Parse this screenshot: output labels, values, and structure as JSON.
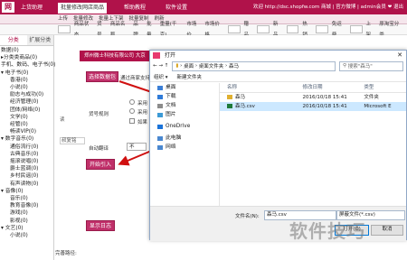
{
  "topnav": {
    "logo": "网",
    "tabs": [
      "上货助理",
      "批量修改网店商品",
      "帮助教程",
      "软件设置"
    ],
    "active_tab": 1,
    "right_text": "欢迎 http://dsc.shopfw.com 商城 | 官方微博 | admin会员 ❤ 退出"
  },
  "subnav": [
    "上传",
    "批量修改",
    "批量上下架",
    "批量复制",
    "刷新"
  ],
  "toolbar": [
    "商品状态",
    "货号",
    "商品名称",
    "品牌",
    "批量",
    "重量(千克)",
    "市场价",
    "市场价格",
    "赠品",
    "新品",
    "热销",
    "免运费",
    "上架",
    "原淘宝分类"
  ],
  "sidebar": {
    "tabs": [
      "分类",
      "扩展分类"
    ],
    "tree": [
      {
        "level": 1,
        "text": "数据(0)"
      },
      {
        "level": 1,
        "text": "▸分类类商品(0)"
      },
      {
        "level": 1,
        "text": "手机、数码、电子书(0)"
      },
      {
        "level": 1,
        "text": "▾ 电子书(0)"
      },
      {
        "level": 2,
        "text": "香港(0)"
      },
      {
        "level": 2,
        "text": "小说(0)"
      },
      {
        "level": 2,
        "text": "励志与成功(0)"
      },
      {
        "level": 2,
        "text": "经济管理(0)"
      },
      {
        "level": 2,
        "text": "团体/网络(0)"
      },
      {
        "level": 2,
        "text": "文学(0)"
      },
      {
        "level": 2,
        "text": "经管(0)"
      },
      {
        "level": 2,
        "text": "畅读VIP(0)"
      },
      {
        "level": 1,
        "text": "▾ 数字音乐(0)"
      },
      {
        "level": 2,
        "text": "通俗流行(0)"
      },
      {
        "level": 2,
        "text": "古典音乐(0)"
      },
      {
        "level": 2,
        "text": "摇滚说唱(0)"
      },
      {
        "level": 2,
        "text": "爵士蓝调(0)"
      },
      {
        "level": 2,
        "text": "乡村民谣(0)"
      },
      {
        "level": 2,
        "text": "有声读物(0)"
      },
      {
        "level": 1,
        "text": "▾ 音像(0)"
      },
      {
        "level": 2,
        "text": "音乐(0)"
      },
      {
        "level": 2,
        "text": "教育音像(0)"
      },
      {
        "level": 2,
        "text": "游戏(0)"
      },
      {
        "level": 2,
        "text": "影视(0)"
      },
      {
        "level": 1,
        "text": "▾ 文艺(0)"
      },
      {
        "level": 2,
        "text": "小说(0)"
      }
    ]
  },
  "main": {
    "panel_title": "郑州微士科技有限公司 大京",
    "select_data_button": "选择数据包",
    "import_label": "通过商家支持文件",
    "goods_rule_label": "货号规则",
    "radio_labels": [
      "采用",
      "采用",
      "如果"
    ],
    "auto_translate_label": "自动翻译",
    "auto_translate_value": "不",
    "start_import_button": "开始引入",
    "show_log_button": "显示日志",
    "left_label_a": "读",
    "left_label_b": "叔复铭",
    "footer": "完善路径:"
  },
  "dialog": {
    "title": "打开",
    "close": "✕",
    "path": [
      "桌面",
      "桌面文件夹",
      "森马"
    ],
    "search_placeholder": "搜索\"森马\"",
    "cmd_organize": "组织 ▾",
    "cmd_new_folder": "新建文件夹",
    "nav": [
      {
        "icon": "desktop-icon",
        "text": "桌面",
        "color": "#3c7fd6"
      },
      {
        "icon": "download-icon",
        "text": "下载",
        "color": "#2f7bd8"
      },
      {
        "icon": "documents-icon",
        "text": "文档",
        "color": "#8c8c8c"
      },
      {
        "icon": "pictures-icon",
        "text": "图片",
        "color": "#3c9ad6"
      },
      {
        "icon": "onedrive-icon",
        "text": "OneDrive",
        "color": "#1a73d9"
      },
      {
        "icon": "pc-icon",
        "text": "此电脑",
        "color": "#4a88d0"
      },
      {
        "icon": "network-icon",
        "text": "网络",
        "color": "#4a88d0"
      }
    ],
    "columns": [
      "名称",
      "修改日期",
      "类型"
    ],
    "files": [
      {
        "name": "森马",
        "date": "2016/10/18 15:41",
        "type": "文件夹",
        "icon": "folder-icon",
        "selected": false
      },
      {
        "name": "森马.csv",
        "date": "2016/10/18 15:41",
        "type": "Microsoft E",
        "icon": "excel-file-icon",
        "selected": true
      }
    ],
    "filename_label": "文件名(N):",
    "filename_value": "森马.csv",
    "filetype_value": "屏蔽文件(*.csv)",
    "open_button": "打开(O)",
    "cancel_button": "取消"
  },
  "watermark": "软件技巧",
  "colors": {
    "brand": "#b0124a",
    "arrow": "#d01010",
    "selection": "#cce8ff"
  }
}
